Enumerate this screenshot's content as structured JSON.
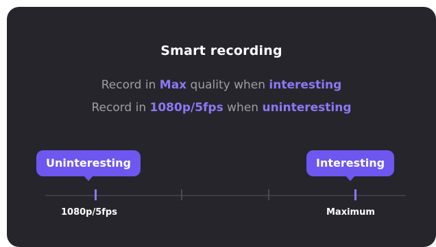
{
  "card": {
    "title": "Smart recording",
    "line1": {
      "prefix": "Record in ",
      "quality": "Max",
      "middle": " quality when ",
      "state": "interesting"
    },
    "line2": {
      "prefix": "Record in ",
      "quality": "1080p/5fps",
      "middle": " when ",
      "state": "uninteresting"
    }
  },
  "slider": {
    "left_bubble": "Uninteresting",
    "right_bubble": "Interesting",
    "left_label": "1080p/5fps",
    "right_label": "Maximum",
    "tick_count": 4
  },
  "colors": {
    "card_background": "#26252b",
    "accent": "#8b78f7",
    "bubble": "#6e57f0",
    "muted_text": "#9e9ea6"
  }
}
